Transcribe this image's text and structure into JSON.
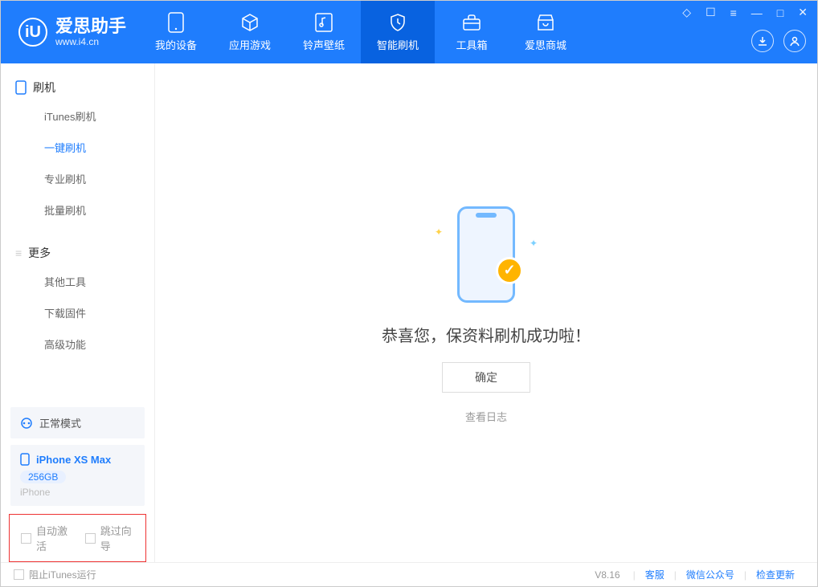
{
  "app": {
    "name": "爱思助手",
    "url": "www.i4.cn"
  },
  "nav": [
    {
      "label": "我的设备",
      "icon": "device"
    },
    {
      "label": "应用游戏",
      "icon": "cube"
    },
    {
      "label": "铃声壁纸",
      "icon": "music"
    },
    {
      "label": "智能刷机",
      "icon": "shield"
    },
    {
      "label": "工具箱",
      "icon": "toolbox"
    },
    {
      "label": "爱思商城",
      "icon": "shop"
    }
  ],
  "sidebar": {
    "section1": {
      "title": "刷机",
      "items": [
        "iTunes刷机",
        "一键刷机",
        "专业刷机",
        "批量刷机"
      ],
      "active": 1
    },
    "section2": {
      "title": "更多",
      "items": [
        "其他工具",
        "下载固件",
        "高级功能"
      ]
    }
  },
  "mode": {
    "label": "正常模式"
  },
  "device": {
    "name": "iPhone XS Max",
    "storage": "256GB",
    "type": "iPhone"
  },
  "checks": {
    "auto_activate": "自动激活",
    "skip_guide": "跳过向导"
  },
  "main": {
    "success_msg": "恭喜您，保资料刷机成功啦！",
    "ok_button": "确定",
    "view_log": "查看日志"
  },
  "statusbar": {
    "block_itunes": "阻止iTunes运行",
    "version": "V8.16",
    "links": [
      "客服",
      "微信公众号",
      "检查更新"
    ]
  }
}
